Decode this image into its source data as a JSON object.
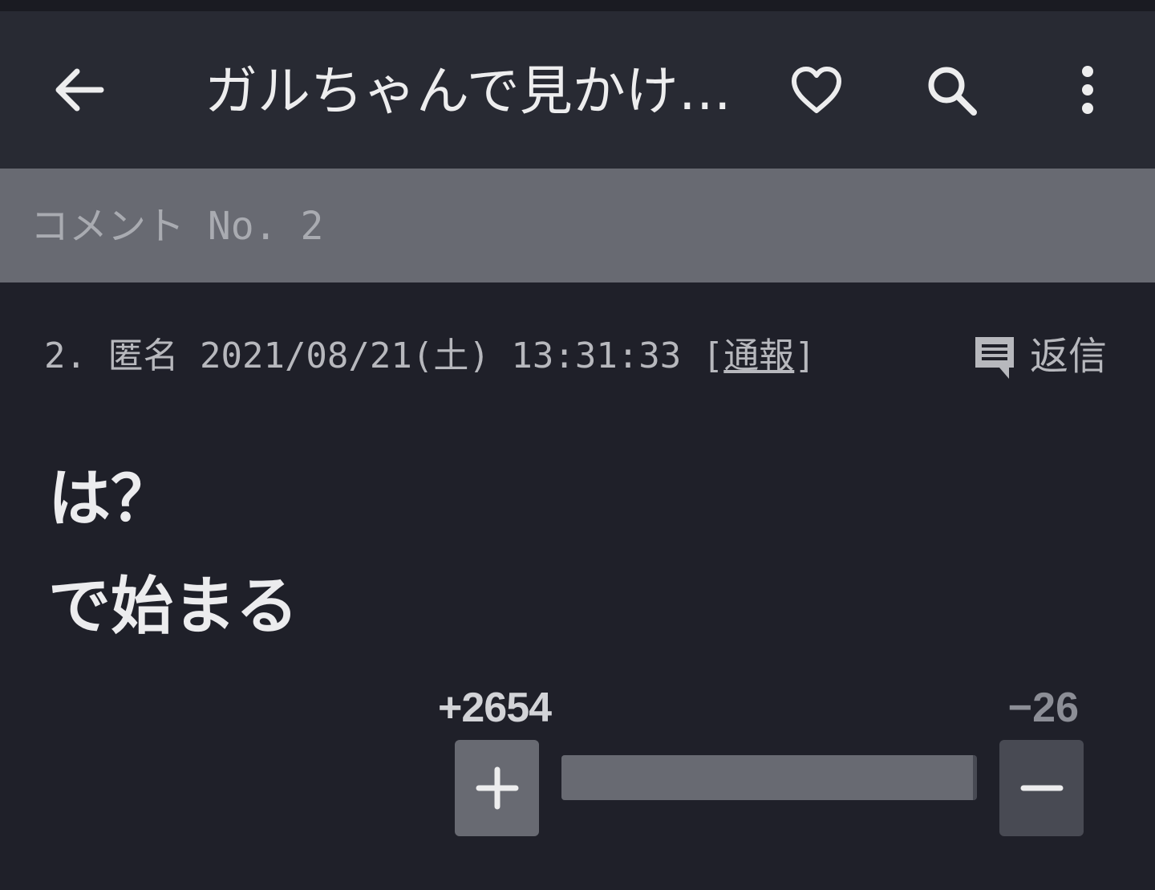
{
  "appbar": {
    "title": "ガルちゃんで見かけ…",
    "back_icon": "arrow-left-icon",
    "favorite_icon": "heart-outline-icon",
    "search_icon": "search-icon",
    "more_icon": "more-vertical-icon"
  },
  "section": {
    "label": "コメント No. 2"
  },
  "comment": {
    "number": "2.",
    "author": "匿名",
    "datetime": "2021/08/21(土) 13:31:33",
    "report_open": "[",
    "report_label": "通報",
    "report_close": "]",
    "reply_label": "返信",
    "reply_icon": "comment-icon",
    "body_lines": [
      "は？",
      "で始まる"
    ]
  },
  "votes": {
    "plus_label": "+2654",
    "minus_label": "−26",
    "plus_fraction": 0.99,
    "plus_icon": "plus-icon",
    "minus_icon": "minus-icon"
  },
  "colors": {
    "background": "#1f2029",
    "appbar": "#282a33",
    "section_header": "#686a72",
    "plus_button": "#686a72",
    "minus_button": "#484a53"
  }
}
